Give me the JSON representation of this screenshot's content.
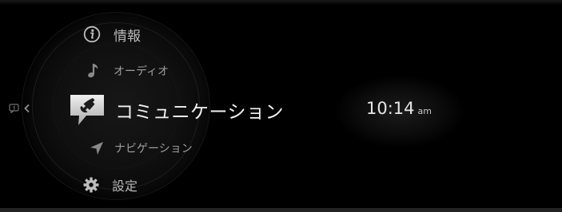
{
  "menu": {
    "items": [
      {
        "id": "info",
        "label": "情報",
        "icon": "info-icon",
        "state": "default"
      },
      {
        "id": "audio",
        "label": "オーディオ",
        "icon": "music-note-icon",
        "state": "dim"
      },
      {
        "id": "communication",
        "label": "コミュニケーション",
        "icon": "phone-icon",
        "state": "selected"
      },
      {
        "id": "navigation",
        "label": "ナビゲーション",
        "icon": "navigation-arrow-icon",
        "state": "dim"
      },
      {
        "id": "settings",
        "label": "設定",
        "icon": "gear-icon",
        "state": "default"
      }
    ]
  },
  "left_indicator": {
    "icons": [
      "notification-icon",
      "chevron-left-icon"
    ]
  },
  "clock": {
    "time": "10:14",
    "ampm": "am"
  },
  "colors": {
    "background": "#000000",
    "selected_text": "#f2f2f2",
    "menu_text": "#b9b9b9",
    "dim_text": "#9e9e9e",
    "selected_icon_bg": "#d9d9d9"
  }
}
